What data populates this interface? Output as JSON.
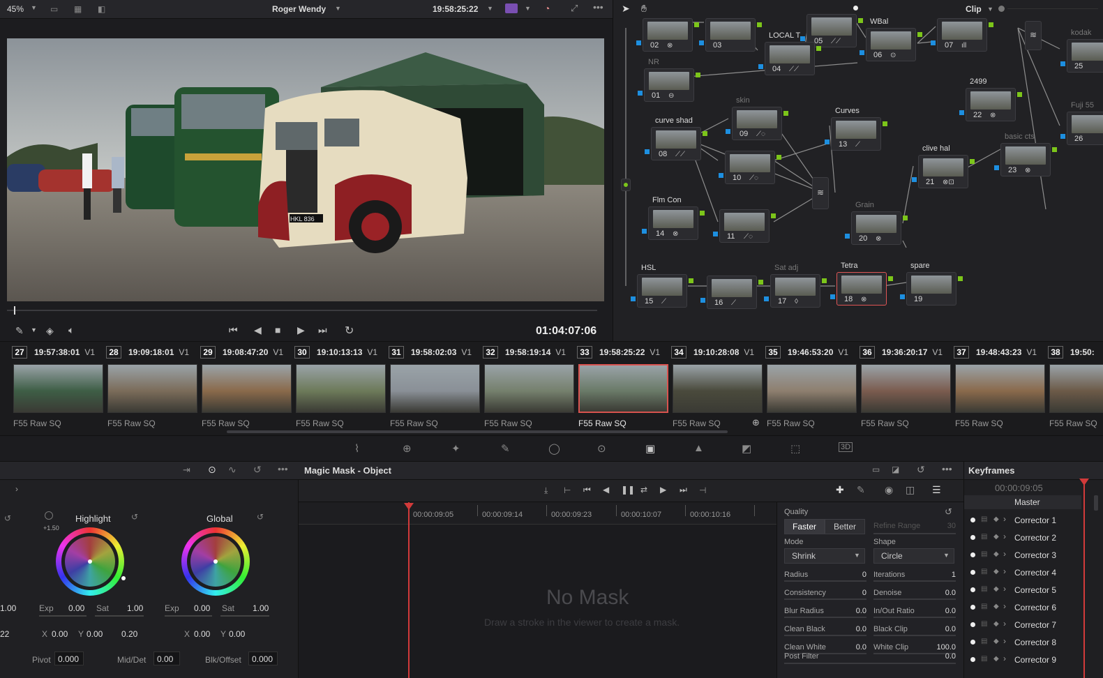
{
  "viewer": {
    "zoom": "45%",
    "clip_name": "Roger Wendy",
    "timecode_header": "19:58:25:22",
    "mode": "Clip",
    "timecode": "01:04:07:06"
  },
  "nodes": [
    {
      "num": "02",
      "label": ""
    },
    {
      "num": "03",
      "label": ""
    },
    {
      "num": "05",
      "label": ""
    },
    {
      "num": "07",
      "label": ""
    },
    {
      "num": "04",
      "label": "LOCAL T"
    },
    {
      "num": "06",
      "label": "WBal"
    },
    {
      "num": "01",
      "label": "NR"
    },
    {
      "num": "08",
      "label": "curve shad"
    },
    {
      "num": "09",
      "label": "skin"
    },
    {
      "num": "10",
      "label": ""
    },
    {
      "num": "11",
      "label": ""
    },
    {
      "num": "13",
      "label": "Curves"
    },
    {
      "num": "14",
      "label": "Flm Con"
    },
    {
      "num": "20",
      "label": "Grain"
    },
    {
      "num": "21",
      "label": "clive hal"
    },
    {
      "num": "22",
      "label": "2499"
    },
    {
      "num": "23",
      "label": "basic cts"
    },
    {
      "num": "25",
      "label": "kodak"
    },
    {
      "num": "26",
      "label": "Fuji 55"
    },
    {
      "num": "15",
      "label": "HSL"
    },
    {
      "num": "16",
      "label": ""
    },
    {
      "num": "17",
      "label": "Sat adj"
    },
    {
      "num": "18",
      "label": "Tetra"
    },
    {
      "num": "19",
      "label": "spare"
    }
  ],
  "clips": [
    {
      "num": "27",
      "tc": "19:57:38:01",
      "track": "V1",
      "name": "F55 Raw SQ"
    },
    {
      "num": "28",
      "tc": "19:09:18:01",
      "track": "V1",
      "name": "F55 Raw SQ"
    },
    {
      "num": "29",
      "tc": "19:08:47:20",
      "track": "V1",
      "name": "F55 Raw SQ"
    },
    {
      "num": "30",
      "tc": "19:10:13:13",
      "track": "V1",
      "name": "F55 Raw SQ"
    },
    {
      "num": "31",
      "tc": "19:58:02:03",
      "track": "V1",
      "name": "F55 Raw SQ"
    },
    {
      "num": "32",
      "tc": "19:58:19:14",
      "track": "V1",
      "name": "F55 Raw SQ"
    },
    {
      "num": "33",
      "tc": "19:58:25:22",
      "track": "V1",
      "name": "F55 Raw SQ"
    },
    {
      "num": "34",
      "tc": "19:10:28:08",
      "track": "V1",
      "name": "F55 Raw SQ"
    },
    {
      "num": "35",
      "tc": "19:46:53:20",
      "track": "V1",
      "name": "F55 Raw SQ"
    },
    {
      "num": "36",
      "tc": "19:36:20:17",
      "track": "V1",
      "name": "F55 Raw SQ"
    },
    {
      "num": "37",
      "tc": "19:48:43:23",
      "track": "V1",
      "name": "F55 Raw SQ"
    },
    {
      "num": "38",
      "tc": "19:50:",
      "track": "",
      "name": "F55 Raw SQ"
    }
  ],
  "wheels": {
    "highlight": {
      "title": "Highlight",
      "exp_label": "Exp",
      "exp": "0.00",
      "sat_label": "Sat",
      "sat": "1.00",
      "x_label": "X",
      "x": "0.00",
      "y_label": "Y",
      "y": "0.00",
      "extra": "0.20",
      "badge": "+1.50"
    },
    "global": {
      "title": "Global",
      "exp_label": "Exp",
      "exp": "0.00",
      "sat_label": "Sat",
      "sat": "1.00",
      "x_label": "X",
      "x": "0.00",
      "y_label": "Y",
      "y": "0.00"
    },
    "left_partial_1": "1.00",
    "left_partial_2": "22",
    "pivot_label": "Pivot",
    "pivot": "0.000",
    "mid_label": "Mid/Det",
    "mid": "0.00",
    "blk_label": "Blk/Offset",
    "blk": "0.000"
  },
  "mask": {
    "title": "Magic Mask - Object",
    "ruler": [
      "00:00:09:05",
      "00:00:09:14",
      "00:00:09:23",
      "00:00:10:07",
      "00:00:10:16"
    ],
    "empty_title": "No Mask",
    "empty_hint": "Draw a stroke in the viewer to create a mask.",
    "quality_label": "Quality",
    "faster": "Faster",
    "better": "Better",
    "refine_label": "Refine Range",
    "refine_val": "30",
    "mode_label": "Mode",
    "mode_val": "Shrink",
    "shape_label": "Shape",
    "shape_val": "Circle",
    "params_left": [
      {
        "label": "Radius",
        "value": "0"
      },
      {
        "label": "Consistency",
        "value": "0"
      },
      {
        "label": "Blur Radius",
        "value": "0.0"
      },
      {
        "label": "Clean Black",
        "value": "0.0"
      },
      {
        "label": "Clean White",
        "value": "0.0"
      }
    ],
    "params_right": [
      {
        "label": "Iterations",
        "value": "1"
      },
      {
        "label": "Denoise",
        "value": "0.0"
      },
      {
        "label": "In/Out Ratio",
        "value": "0.0"
      },
      {
        "label": "Black Clip",
        "value": "0.0"
      },
      {
        "label": "White Clip",
        "value": "100.0"
      }
    ],
    "post_filter_label": "Post Filter",
    "post_filter_val": "0.0"
  },
  "keyframes": {
    "title": "Keyframes",
    "timecode": "00:00:09:05",
    "master": "Master",
    "rows": [
      "Corrector 1",
      "Corrector 2",
      "Corrector 3",
      "Corrector 4",
      "Corrector 5",
      "Corrector 6",
      "Corrector 7",
      "Corrector 8",
      "Corrector 9"
    ]
  }
}
